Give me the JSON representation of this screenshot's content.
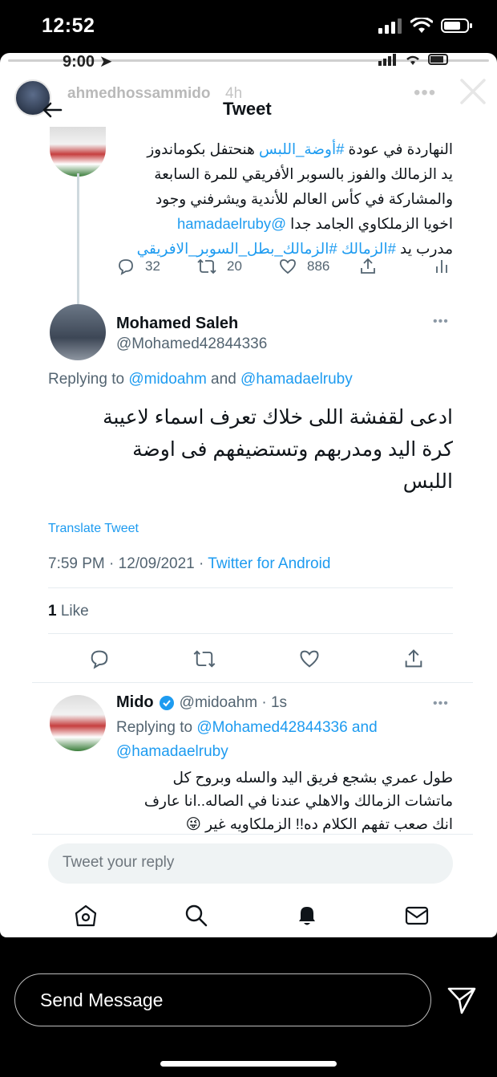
{
  "os": {
    "time": "12:52"
  },
  "story": {
    "inner_time": "9:00",
    "username": "ahmedhossammido",
    "age": "4h",
    "more": "•••"
  },
  "tweet_view": {
    "title": "Tweet"
  },
  "parent_tweet": {
    "line1": "النهاردة في عودة ",
    "hashtag1": "#أوضة_اللبس",
    "line1b": " هنحتفل بكوماندوز",
    "line2": "يد الزمالك والفوز بالسوبر الأفريقي للمرة السابعة",
    "line3": "والمشاركة في كأس العالم للأندية ويشرفني وجود",
    "line4a": "اخويا الزملكاوي الجامد جدا ",
    "mention": "@hamadaelruby",
    "line5a": "مدرب يد ",
    "hashtag2": "#الزمالك",
    "hashtag3": "#الزمالك_بطل_السوبر_الافريقي",
    "replies": "32",
    "retweets": "20",
    "likes": "886"
  },
  "main_tweet": {
    "name": "Mohamed Saleh",
    "handle": "@Mohamed42844336",
    "replying_prefix": "Replying to ",
    "replying_to_1": "@midoahm",
    "replying_and": " and ",
    "replying_to_2": "@hamadaelruby",
    "text_line1": "ادعى لقفشة اللى خلاك تعرف اسماء لاعيبة",
    "text_line2": "كرة اليد ومدربهم وتستضيفهم فى اوضة",
    "text_line3": "اللبس",
    "translate": "Translate Tweet",
    "timestamp": "7:59 PM · 12/09/2021 · ",
    "source": "Twitter for Android",
    "like_count": "1",
    "like_label": " Like"
  },
  "reply_tweet": {
    "name": "Mido",
    "handle": "@midoahm · 1s",
    "replying_prefix": "Replying to ",
    "replying_to_1": "@Mohamed42844336",
    "replying_and": " and",
    "replying_to_2": "@hamadaelruby",
    "text_line1": "طول عمري بشجع فريق اليد والسله وبروح كل",
    "text_line2": "ماتشات الزمالك والاهلي عندنا في الصاله..انا عارف",
    "text_line3": "انك صعب تفهم الكلام ده!! الزملكاويه غير 😜"
  },
  "compose": {
    "placeholder": "Tweet your reply"
  },
  "message": {
    "placeholder": "Send Message"
  },
  "colors": {
    "accent": "#1d9bf0",
    "verified": "#1d9bf0"
  }
}
